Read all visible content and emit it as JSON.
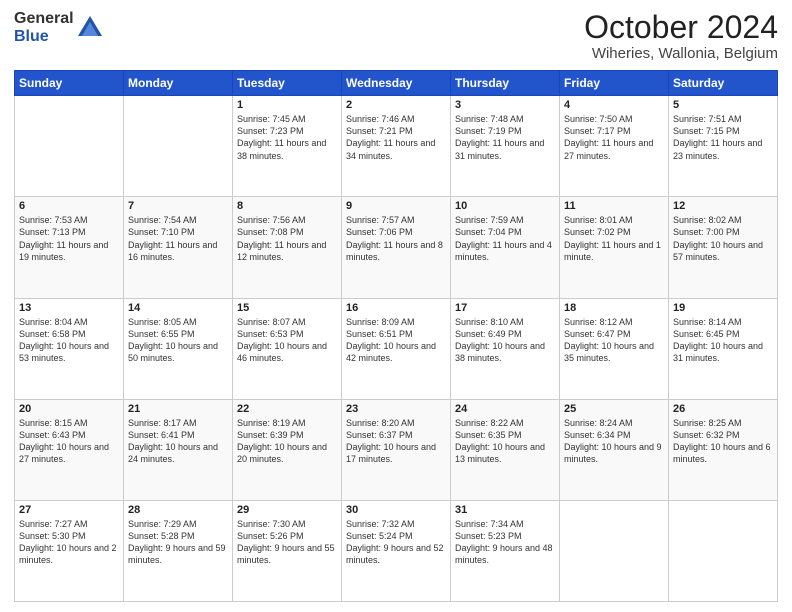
{
  "header": {
    "logo_general": "General",
    "logo_blue": "Blue",
    "month_title": "October 2024",
    "location": "Wiheries, Wallonia, Belgium"
  },
  "days_of_week": [
    "Sunday",
    "Monday",
    "Tuesday",
    "Wednesday",
    "Thursday",
    "Friday",
    "Saturday"
  ],
  "weeks": [
    [
      {
        "day": "",
        "content": ""
      },
      {
        "day": "",
        "content": ""
      },
      {
        "day": "1",
        "content": "Sunrise: 7:45 AM\nSunset: 7:23 PM\nDaylight: 11 hours and 38 minutes."
      },
      {
        "day": "2",
        "content": "Sunrise: 7:46 AM\nSunset: 7:21 PM\nDaylight: 11 hours and 34 minutes."
      },
      {
        "day": "3",
        "content": "Sunrise: 7:48 AM\nSunset: 7:19 PM\nDaylight: 11 hours and 31 minutes."
      },
      {
        "day": "4",
        "content": "Sunrise: 7:50 AM\nSunset: 7:17 PM\nDaylight: 11 hours and 27 minutes."
      },
      {
        "day": "5",
        "content": "Sunrise: 7:51 AM\nSunset: 7:15 PM\nDaylight: 11 hours and 23 minutes."
      }
    ],
    [
      {
        "day": "6",
        "content": "Sunrise: 7:53 AM\nSunset: 7:13 PM\nDaylight: 11 hours and 19 minutes."
      },
      {
        "day": "7",
        "content": "Sunrise: 7:54 AM\nSunset: 7:10 PM\nDaylight: 11 hours and 16 minutes."
      },
      {
        "day": "8",
        "content": "Sunrise: 7:56 AM\nSunset: 7:08 PM\nDaylight: 11 hours and 12 minutes."
      },
      {
        "day": "9",
        "content": "Sunrise: 7:57 AM\nSunset: 7:06 PM\nDaylight: 11 hours and 8 minutes."
      },
      {
        "day": "10",
        "content": "Sunrise: 7:59 AM\nSunset: 7:04 PM\nDaylight: 11 hours and 4 minutes."
      },
      {
        "day": "11",
        "content": "Sunrise: 8:01 AM\nSunset: 7:02 PM\nDaylight: 11 hours and 1 minute."
      },
      {
        "day": "12",
        "content": "Sunrise: 8:02 AM\nSunset: 7:00 PM\nDaylight: 10 hours and 57 minutes."
      }
    ],
    [
      {
        "day": "13",
        "content": "Sunrise: 8:04 AM\nSunset: 6:58 PM\nDaylight: 10 hours and 53 minutes."
      },
      {
        "day": "14",
        "content": "Sunrise: 8:05 AM\nSunset: 6:55 PM\nDaylight: 10 hours and 50 minutes."
      },
      {
        "day": "15",
        "content": "Sunrise: 8:07 AM\nSunset: 6:53 PM\nDaylight: 10 hours and 46 minutes."
      },
      {
        "day": "16",
        "content": "Sunrise: 8:09 AM\nSunset: 6:51 PM\nDaylight: 10 hours and 42 minutes."
      },
      {
        "day": "17",
        "content": "Sunrise: 8:10 AM\nSunset: 6:49 PM\nDaylight: 10 hours and 38 minutes."
      },
      {
        "day": "18",
        "content": "Sunrise: 8:12 AM\nSunset: 6:47 PM\nDaylight: 10 hours and 35 minutes."
      },
      {
        "day": "19",
        "content": "Sunrise: 8:14 AM\nSunset: 6:45 PM\nDaylight: 10 hours and 31 minutes."
      }
    ],
    [
      {
        "day": "20",
        "content": "Sunrise: 8:15 AM\nSunset: 6:43 PM\nDaylight: 10 hours and 27 minutes."
      },
      {
        "day": "21",
        "content": "Sunrise: 8:17 AM\nSunset: 6:41 PM\nDaylight: 10 hours and 24 minutes."
      },
      {
        "day": "22",
        "content": "Sunrise: 8:19 AM\nSunset: 6:39 PM\nDaylight: 10 hours and 20 minutes."
      },
      {
        "day": "23",
        "content": "Sunrise: 8:20 AM\nSunset: 6:37 PM\nDaylight: 10 hours and 17 minutes."
      },
      {
        "day": "24",
        "content": "Sunrise: 8:22 AM\nSunset: 6:35 PM\nDaylight: 10 hours and 13 minutes."
      },
      {
        "day": "25",
        "content": "Sunrise: 8:24 AM\nSunset: 6:34 PM\nDaylight: 10 hours and 9 minutes."
      },
      {
        "day": "26",
        "content": "Sunrise: 8:25 AM\nSunset: 6:32 PM\nDaylight: 10 hours and 6 minutes."
      }
    ],
    [
      {
        "day": "27",
        "content": "Sunrise: 7:27 AM\nSunset: 5:30 PM\nDaylight: 10 hours and 2 minutes."
      },
      {
        "day": "28",
        "content": "Sunrise: 7:29 AM\nSunset: 5:28 PM\nDaylight: 9 hours and 59 minutes."
      },
      {
        "day": "29",
        "content": "Sunrise: 7:30 AM\nSunset: 5:26 PM\nDaylight: 9 hours and 55 minutes."
      },
      {
        "day": "30",
        "content": "Sunrise: 7:32 AM\nSunset: 5:24 PM\nDaylight: 9 hours and 52 minutes."
      },
      {
        "day": "31",
        "content": "Sunrise: 7:34 AM\nSunset: 5:23 PM\nDaylight: 9 hours and 48 minutes."
      },
      {
        "day": "",
        "content": ""
      },
      {
        "day": "",
        "content": ""
      }
    ]
  ]
}
